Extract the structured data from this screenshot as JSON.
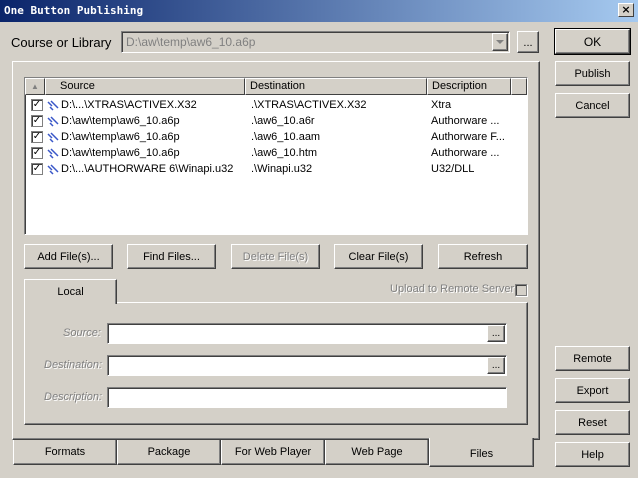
{
  "window": {
    "title": "One Button Publishing",
    "close_glyph": "×"
  },
  "course": {
    "label": "Course or Library",
    "value": "D:\\aw\\temp\\aw6_10.a6p",
    "browse": "..."
  },
  "side_buttons": {
    "ok": "OK",
    "publish": "Publish",
    "cancel": "Cancel",
    "remote": "Remote",
    "export": "Export",
    "reset": "Reset",
    "help": "Help"
  },
  "files_table": {
    "columns": [
      "Source",
      "Destination",
      "Description"
    ],
    "sort_glyph": "▲",
    "rows": [
      {
        "checked": "✓",
        "source": "D:\\...\\XTRAS\\ACTIVEX.X32",
        "destination": ".\\XTRAS\\ACTIVEX.X32",
        "description": "Xtra"
      },
      {
        "checked": "✓",
        "source": "D:\\aw\\temp\\aw6_10.a6p",
        "destination": ".\\aw6_10.a6r",
        "description": "Authorware ..."
      },
      {
        "checked": "✓",
        "source": "D:\\aw\\temp\\aw6_10.a6p",
        "destination": ".\\aw6_10.aam",
        "description": "Authorware F..."
      },
      {
        "checked": "✓",
        "source": "D:\\aw\\temp\\aw6_10.a6p",
        "destination": ".\\aw6_10.htm",
        "description": "Authorware ..."
      },
      {
        "checked": "✓",
        "source": "D:\\...\\AUTHORWARE 6\\Winapi.u32",
        "destination": ".\\Winapi.u32",
        "description": "U32/DLL"
      }
    ]
  },
  "file_buttons": {
    "add": "Add File(s)...",
    "find": "Find Files...",
    "delete": "Delete File(s)",
    "clear": "Clear File(s)",
    "refresh": "Refresh"
  },
  "local_tab": {
    "tab_label": "Local",
    "upload_label": "Upload to Remote Server",
    "source_label": "Source:",
    "destination_label": "Destination:",
    "description_label": "Description:",
    "browse": "..."
  },
  "bottom_tabs": [
    "Formats",
    "Package",
    "For Web Player",
    "Web Page",
    "Files"
  ]
}
